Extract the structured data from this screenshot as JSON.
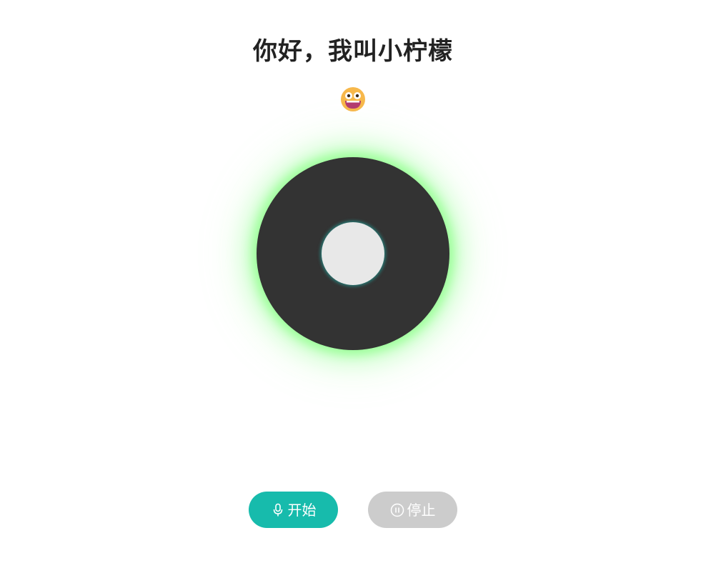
{
  "header": {
    "title": "你好，我叫小柠檬"
  },
  "avatar": {
    "icon": "grinning-face-emoji-icon"
  },
  "orb": {
    "glow_color": "#9dff9a",
    "body_color": "#333333",
    "core_color": "#e8e8e8"
  },
  "controls": {
    "start_label": "开始",
    "start_icon": "microphone-icon",
    "start_color": "#17bbac",
    "stop_label": "停止",
    "stop_icon": "pause-circle-icon",
    "stop_color": "#cccccc"
  }
}
